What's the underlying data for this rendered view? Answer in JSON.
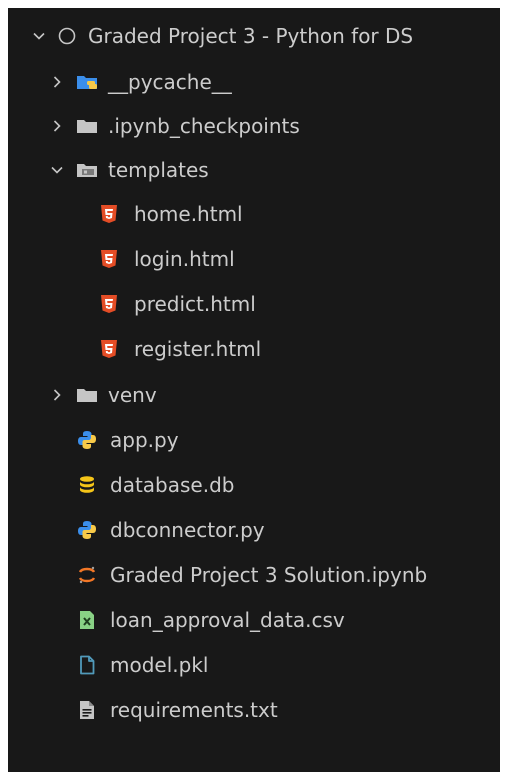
{
  "explorer": {
    "root": {
      "label": "Graded Project 3 - Python for DS",
      "icon": "circle-icon",
      "expanded": true
    },
    "items": [
      {
        "label": "__pycache__",
        "icon": "python-folder-icon",
        "type": "folder",
        "expanded": false,
        "depth": 1
      },
      {
        "label": ".ipynb_checkpoints",
        "icon": "folder-icon",
        "type": "folder",
        "expanded": false,
        "depth": 1
      },
      {
        "label": "templates",
        "icon": "templates-folder-icon",
        "type": "folder",
        "expanded": true,
        "depth": 1
      },
      {
        "label": "home.html",
        "icon": "html5-icon",
        "type": "file",
        "depth": 2
      },
      {
        "label": "login.html",
        "icon": "html5-icon",
        "type": "file",
        "depth": 2
      },
      {
        "label": "predict.html",
        "icon": "html5-icon",
        "type": "file",
        "depth": 2
      },
      {
        "label": "register.html",
        "icon": "html5-icon",
        "type": "file",
        "depth": 2
      },
      {
        "label": "venv",
        "icon": "folder-icon",
        "type": "folder",
        "expanded": false,
        "depth": 1
      },
      {
        "label": "app.py",
        "icon": "python-icon",
        "type": "file",
        "depth": 1
      },
      {
        "label": "database.db",
        "icon": "database-icon",
        "type": "file",
        "depth": 1
      },
      {
        "label": "dbconnector.py",
        "icon": "python-icon",
        "type": "file",
        "depth": 1
      },
      {
        "label": "Graded Project 3 Solution.ipynb",
        "icon": "jupyter-icon",
        "type": "file",
        "depth": 1
      },
      {
        "label": "loan_approval_data.csv",
        "icon": "csv-icon",
        "type": "file",
        "depth": 1
      },
      {
        "label": "model.pkl",
        "icon": "file-icon",
        "type": "file",
        "depth": 1
      },
      {
        "label": "requirements.txt",
        "icon": "text-file-icon",
        "type": "file",
        "depth": 1
      }
    ]
  },
  "colors": {
    "background": "#181818",
    "text": "#cccccc",
    "chevron": "#c5c5c5",
    "html": "#e44d26",
    "python_blue": "#3572a5",
    "python_yellow": "#f7c948",
    "database": "#f5c518",
    "jupyter": "#f37726",
    "csv": "#89d185",
    "file_blue": "#519aba",
    "folder": "#c5c5c5"
  }
}
